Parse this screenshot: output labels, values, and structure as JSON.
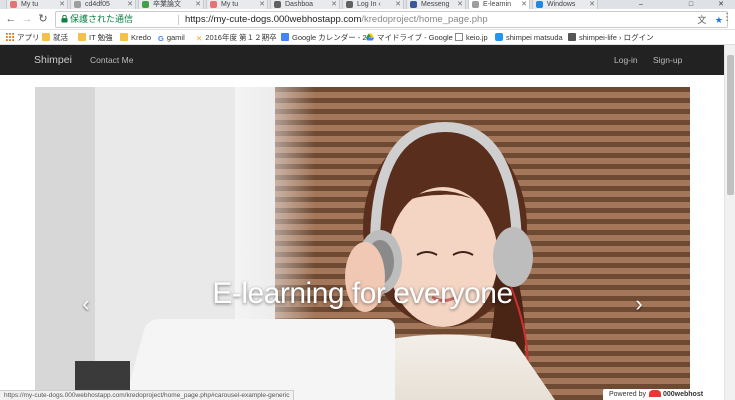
{
  "browser": {
    "tabs": [
      {
        "label": "My tu",
        "color": "#e57373"
      },
      {
        "label": "cd4df05",
        "color": "#9e9e9e"
      },
      {
        "label": "卒業論文",
        "color": "#43a047"
      },
      {
        "label": "My tu",
        "color": "#e57373"
      },
      {
        "label": "Dashboa",
        "color": "#616161"
      },
      {
        "label": "Log In ‹",
        "color": "#616161"
      },
      {
        "label": "Messeng",
        "color": "#3b5998"
      },
      {
        "label": "E-learnin",
        "color": "#9e9e9e"
      },
      {
        "label": "Windows",
        "color": "#1e88e5"
      }
    ],
    "window_controls": {
      "minimize": "–",
      "maximize": "□",
      "close": "✕"
    },
    "security_label": "保護された通信",
    "url_host": "https://my-cute-dogs.000webhostapp.com",
    "url_path": "/kredoproject/home_page.php",
    "bookmarks": [
      {
        "label": "アプリ",
        "icon": "apps-icon"
      },
      {
        "label": "就活",
        "icon": "folder-icon"
      },
      {
        "label": "IT 勉強",
        "icon": "folder-icon"
      },
      {
        "label": "Kredo",
        "icon": "folder-icon"
      },
      {
        "label": "gamil",
        "icon": "google-icon"
      },
      {
        "label": "2016年度 第１２期卒",
        "icon": "x-icon"
      },
      {
        "label": "Google カレンダー - 20",
        "icon": "calendar-icon"
      },
      {
        "label": "マイドライブ - Google",
        "icon": "drive-icon"
      },
      {
        "label": "keio.jp",
        "icon": "page-icon"
      },
      {
        "label": "shimpei matsuda",
        "icon": "cloud-icon"
      },
      {
        "label": "shimpei-life › ログイン",
        "icon": "blog-icon"
      }
    ]
  },
  "site": {
    "brand": "Shimpei",
    "nav_contact": "Contact Me",
    "nav_login": "Log-in",
    "nav_signup": "Sign-up",
    "hero_caption": "E-learning for everyone",
    "prev_glyph": "‹",
    "next_glyph": "›"
  },
  "status_url": "https://my-cute-dogs.000webhostapp.com/kredoproject/home_page.php#carousel-example-generic",
  "powered_prefix": "Powered by",
  "powered_brand": "000webhost"
}
